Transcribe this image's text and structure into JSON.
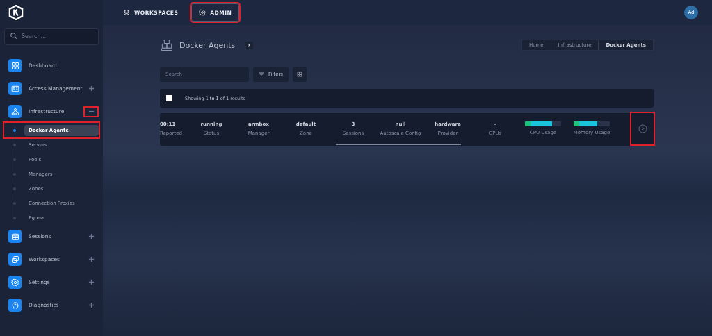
{
  "topnav": [
    {
      "label": "WORKSPACES",
      "selected": false,
      "highlighted": false
    },
    {
      "label": "ADMIN",
      "selected": true,
      "highlighted": true
    }
  ],
  "avatar": "Ad",
  "sidebar": {
    "search": {
      "placeholder": "Search..."
    },
    "items": [
      {
        "label": "Dashboard"
      },
      {
        "label": "Access Management",
        "expanded": false,
        "highlighted": false
      },
      {
        "label": "Infrastructure",
        "expanded": true,
        "highlighted": true,
        "children": [
          {
            "label": "Docker Agents",
            "selected": true,
            "highlighted": true
          },
          {
            "label": "Servers",
            "selected": false,
            "highlighted": false
          },
          {
            "label": "Pools",
            "selected": false,
            "highlighted": false
          },
          {
            "label": "Managers",
            "selected": false,
            "highlighted": false
          },
          {
            "label": "Zones",
            "selected": false,
            "highlighted": false
          },
          {
            "label": "Connection Proxies",
            "selected": false,
            "highlighted": false
          },
          {
            "label": "Egress",
            "selected": false,
            "highlighted": false
          }
        ]
      },
      {
        "label": "Sessions",
        "expanded": false,
        "highlighted": false
      },
      {
        "label": "Workspaces",
        "expanded": false,
        "highlighted": false
      },
      {
        "label": "Settings",
        "expanded": false,
        "highlighted": false
      },
      {
        "label": "Diagnostics",
        "expanded": false,
        "highlighted": false
      }
    ]
  },
  "page": {
    "title": "Docker Agents",
    "help": "?",
    "breadcrumb": [
      "Home",
      "Infrastructure",
      "Docker Agents"
    ],
    "search": {
      "placeholder": "Search"
    },
    "filters": "Filters",
    "select_all": {
      "checked": false
    },
    "summary": "Showing **1 to 1** of **1** results",
    "row": {
      "cells": [
        {
          "value": "00:11",
          "label": "Reported"
        },
        {
          "value": "running",
          "label": "Status"
        },
        {
          "value": "armbox",
          "label": "Manager"
        },
        {
          "value": "default",
          "label": "Zone"
        },
        {
          "value": "3",
          "label": "Sessions"
        },
        {
          "value": "null",
          "label": "Autoscale Config"
        },
        {
          "value": "hardware",
          "label": "Provider"
        },
        {
          "value": "-",
          "label": "GPUs"
        }
      ],
      "meters": [
        {
          "label": "CPU Usage",
          "level": 0.75
        },
        {
          "label": "Memory Usage",
          "level": 0.66
        }
      ],
      "detail_highlighted": true
    }
  }
}
